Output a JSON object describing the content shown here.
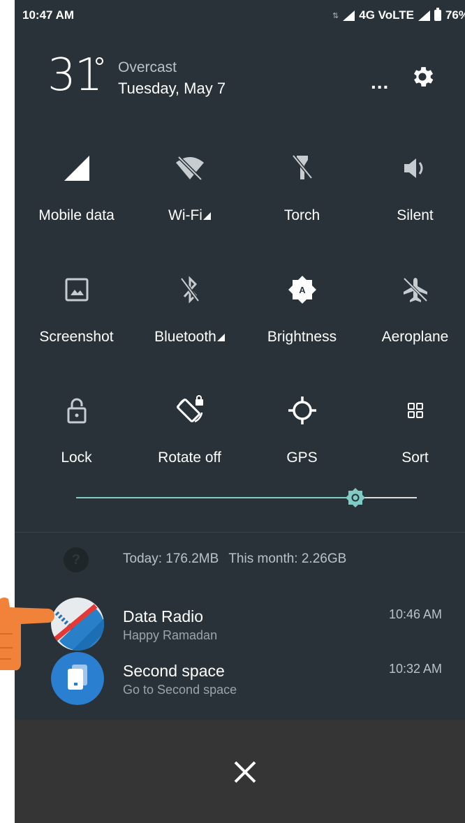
{
  "status_bar": {
    "time": "10:47 AM",
    "network_activity": "⇅",
    "network": "4G VoLTE",
    "battery": "76%"
  },
  "header": {
    "temperature": "31",
    "condition": "Overcast",
    "date": "Tuesday, May 7",
    "more_label": "..."
  },
  "tiles": [
    {
      "label": "Mobile data",
      "icon": "signal-icon"
    },
    {
      "label": "Wi-Fi",
      "icon": "wifi-off-icon"
    },
    {
      "label": "Torch",
      "icon": "torch-off-icon"
    },
    {
      "label": "Silent",
      "icon": "speaker-icon"
    },
    {
      "label": "Screenshot",
      "icon": "screenshot-icon"
    },
    {
      "label": "Bluetooth",
      "icon": "bluetooth-off-icon"
    },
    {
      "label": "Brightness",
      "icon": "brightness-auto-icon"
    },
    {
      "label": "Aeroplane",
      "icon": "airplane-icon"
    },
    {
      "label": "Lock",
      "icon": "lock-icon"
    },
    {
      "label": "Rotate off",
      "icon": "rotate-lock-icon"
    },
    {
      "label": "GPS",
      "icon": "gps-icon"
    },
    {
      "label": "Sort",
      "icon": "grid-icon"
    }
  ],
  "brightness": {
    "level": 0.82
  },
  "data_usage": {
    "today": "Today: 176.2MB",
    "month": "This month: 2.26GB",
    "icon_glyph": "?"
  },
  "notifications": [
    {
      "title": "Data Radio",
      "subtitle": "Happy Ramadan",
      "time": "10:46 AM",
      "icon": "data-radio-app-icon"
    },
    {
      "title": "Second space",
      "subtitle": "Go to Second space",
      "time": "10:32 AM",
      "icon": "second-space-app-icon"
    }
  ],
  "colors": {
    "panel": "#283238",
    "accent": "#80cbc4",
    "bottom_bar": "#353535",
    "pointer": "#f0823a"
  }
}
